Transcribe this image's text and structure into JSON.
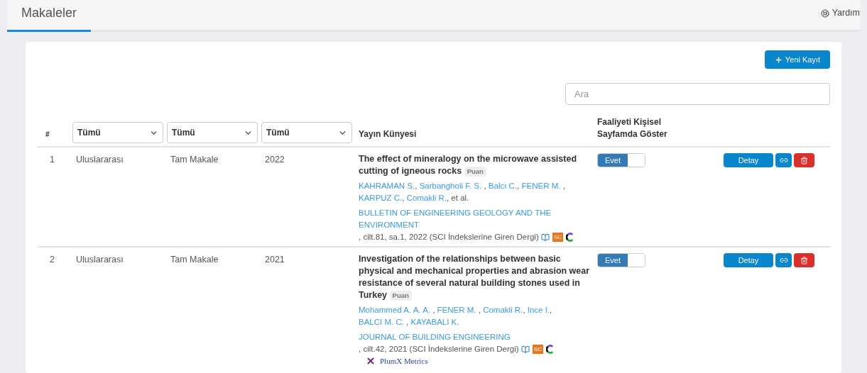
{
  "tab": {
    "label": "Makaleler",
    "selected": true
  },
  "help": "Yardım",
  "new_button": "Yeni Kayıt",
  "search": {
    "placeholder": "Ara"
  },
  "table": {
    "columns": {
      "index": "#",
      "filters": [
        "Tümü",
        "Tümü",
        "Tümü"
      ],
      "citation": "Yayın Künyesi",
      "show": "Faaliyeti Kişisel Sayfamda Göster"
    },
    "rows": [
      {
        "index": "1",
        "scope": "Uluslararası",
        "type": "Tam Makale",
        "year": "2022",
        "title": "The effect of mineralogy on the microwave assisted cutting of igneous rocks",
        "badge": "Puan",
        "authors": [
          {
            "name": "KAHRAMAN S.",
            "sep": ", "
          },
          {
            "name": "Sarbangholi F. S.",
            "sep": " , "
          },
          {
            "name": "Balcı C.",
            "sep": ", "
          },
          {
            "name": "FENER M.",
            "sep": " , "
          },
          {
            "name": "KARPUZ C.",
            "sep": ", "
          },
          {
            "name": "Comakli R.",
            "sep": ", "
          }
        ],
        "authors_suffix": "et al.",
        "journal": "BULLETIN OF ENGINEERING GEOLOGY AND THE ENVIRONMENT",
        "details": " , cilt.81, sa.1, 2022 (SCI İndekslerine Giren Dergi)",
        "sc": "SC",
        "toggle": {
          "label": "Evet",
          "on": true
        },
        "detail_button": "Detay"
      },
      {
        "index": "2",
        "scope": "Uluslararası",
        "type": "Tam Makale",
        "year": "2021",
        "title": "Investigation of the relationships between basic physical and mechanical properties and abrasion wear resistance of several natural building stones used in Turkey",
        "badge": "Puan",
        "authors": [
          {
            "name": "Mohammed A. A. A.",
            "sep": " , "
          },
          {
            "name": "FENER M.",
            "sep": " , "
          },
          {
            "name": "Comakli R.",
            "sep": ", "
          },
          {
            "name": "Ince I.",
            "sep": ", "
          },
          {
            "name": "BALCI M. C.",
            "sep": " , "
          },
          {
            "name": "KAYABALI K."
          }
        ],
        "journal": "JOURNAL OF BUILDING ENGINEERING",
        "details": " , cilt.42, 2021 (SCI İndekslerine Giren Dergi)",
        "sc": "SC",
        "toggle": {
          "label": "Evet",
          "on": true
        },
        "detail_button": "Detay",
        "plumx": "PlumX Metrics"
      }
    ]
  }
}
